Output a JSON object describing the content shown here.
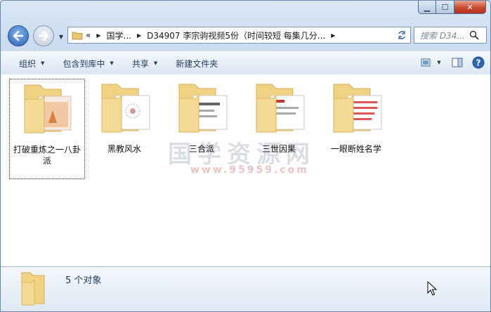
{
  "address": {
    "crumbs": [
      "«",
      "国学...",
      "D34907 李宗驹视频5份（时间较短 每集几分..."
    ]
  },
  "search": {
    "placeholder": "搜索 D34..."
  },
  "toolbar": {
    "organize": "组织",
    "include": "包含到库中",
    "share": "共享",
    "new_folder": "新建文件夹"
  },
  "folders": [
    {
      "name": "打破重炼之一八卦派",
      "selected": true
    },
    {
      "name": "黑教风水",
      "selected": false
    },
    {
      "name": "三合派",
      "selected": false
    },
    {
      "name": "三世因果",
      "selected": false
    },
    {
      "name": "一眼断姓名学",
      "selected": false
    }
  ],
  "watermark": {
    "main": "国学资源网",
    "sub": "www.95959.com"
  },
  "status": {
    "count_text": "5 个对象"
  },
  "colors": {
    "folder": "#f2d58a",
    "selection": "#cce4f7",
    "accent": "#1e3a5f"
  }
}
